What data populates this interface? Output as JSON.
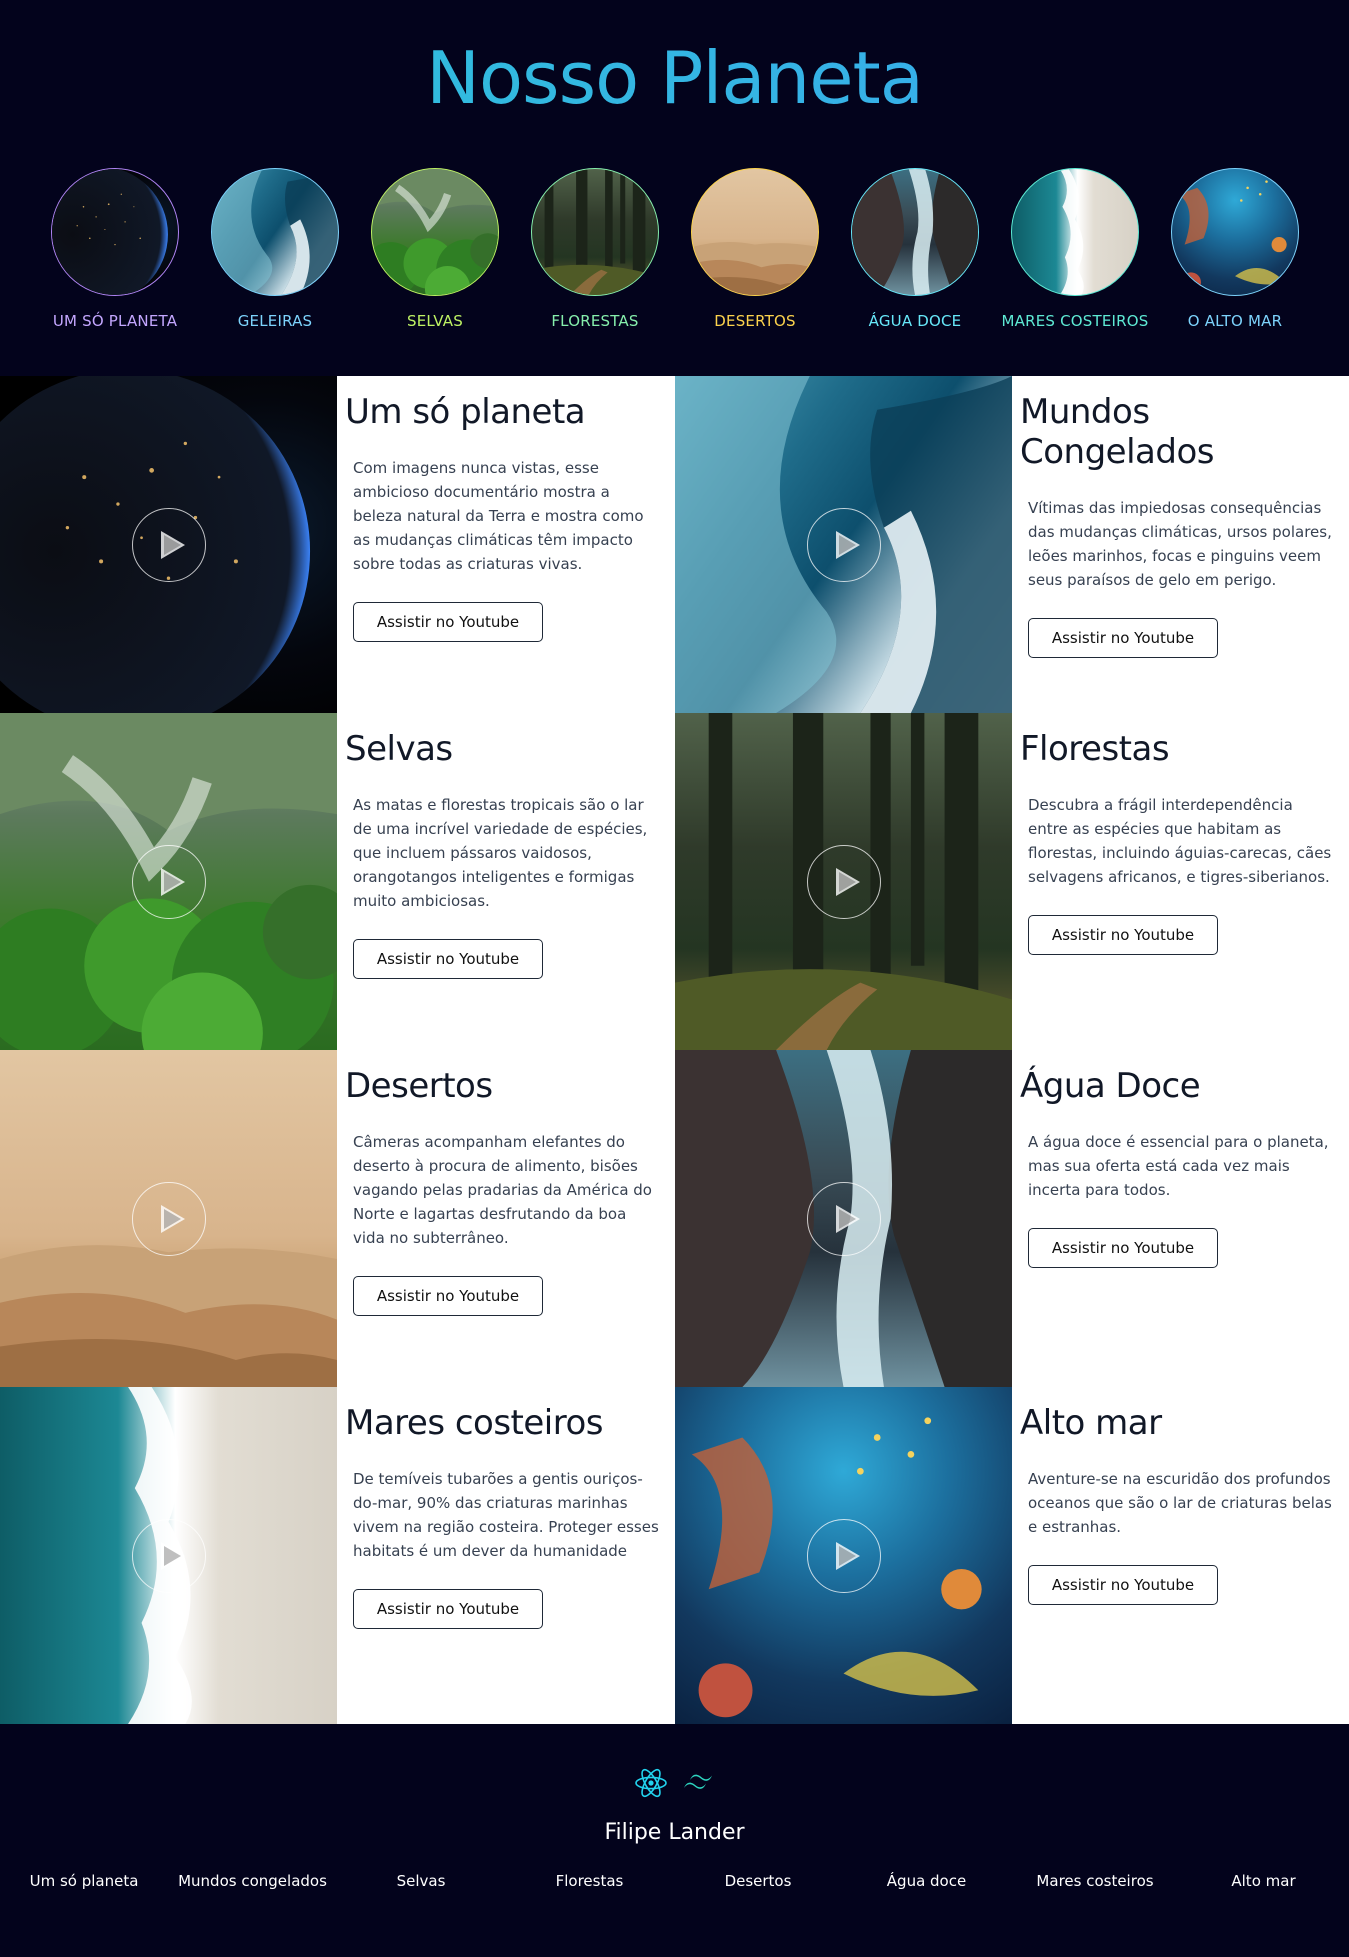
{
  "header": {
    "title": "Nosso Planeta",
    "circles": [
      {
        "label": "UM SÓ PLANETA",
        "color": "#c4a7ff",
        "border": "#b085f5",
        "img": "planeta"
      },
      {
        "label": "GELEIRAS",
        "color": "#7dd3fc",
        "border": "#7dd3fc",
        "img": "geleiras"
      },
      {
        "label": "SELVAS",
        "color": "#bef264",
        "border": "#bef264",
        "img": "selvas"
      },
      {
        "label": "FLORESTAS",
        "color": "#86efac",
        "border": "#86efac",
        "img": "florestas"
      },
      {
        "label": "DESERTOS",
        "color": "#fcd34d",
        "border": "#fcd34d",
        "img": "desertos"
      },
      {
        "label": "ÁGUA DOCE",
        "color": "#67e8f9",
        "border": "#67e8f9",
        "img": "agua"
      },
      {
        "label": "MARES COSTEIROS",
        "color": "#5eead4",
        "border": "#5eead4",
        "img": "mares"
      },
      {
        "label": "O ALTO MAR",
        "color": "#7dd3fc",
        "border": "#7dd3fc",
        "img": "altomar"
      }
    ]
  },
  "cards": [
    {
      "title": "Um só planeta",
      "text": "Com imagens nunca vistas, esse ambicioso documentário mostra a beleza natural da Terra e mostra como as mudanças climáticas têm impacto sobre todas as criaturas vivas.",
      "button": "Assistir no Youtube",
      "img": "planeta"
    },
    {
      "title": "Mundos Congelados",
      "text": "Vítimas das impiedosas consequências das mudanças climáticas, ursos polares, leões marinhos, focas e pinguins veem seus paraísos de gelo em perigo.",
      "button": "Assistir no Youtube",
      "img": "geleiras"
    },
    {
      "title": "Selvas",
      "text": "As matas e florestas tropicais são o lar de uma incrível variedade de espécies, que incluem pássaros vaidosos, orangotangos inteligentes e formigas muito ambiciosas.",
      "button": "Assistir no Youtube",
      "img": "selvas"
    },
    {
      "title": "Florestas",
      "text": "Descubra a frágil interdependência entre as espécies que habitam as florestas, incluindo águias-carecas, cães selvagens africanos, e tigres-siberianos.",
      "button": "Assistir no Youtube",
      "img": "florestas"
    },
    {
      "title": "Desertos",
      "text": "Câmeras acompanham elefantes do deserto à procura de alimento, bisões vagando pelas pradarias da América do Norte e lagartas desfrutando da boa vida no subterrâneo.",
      "button": "Assistir no Youtube",
      "img": "desertos"
    },
    {
      "title": "Água Doce",
      "text": "A água doce é essencial para o planeta, mas sua oferta está cada vez mais incerta para todos.",
      "button": "Assistir no Youtube",
      "img": "agua"
    },
    {
      "title": "Mares costeiros",
      "text": "De temíveis tubarões a gentis ouriços-do-mar, 90% das criaturas marinhas vivem na região costeira. Proteger esses habitats é um dever da humanidade",
      "button": "Assistir no Youtube",
      "img": "mares"
    },
    {
      "title": "Alto mar",
      "text": "Aventure-se na escuridão dos profundos oceanos que são o lar de criaturas belas e estranhas.",
      "button": "Assistir no Youtube",
      "img": "altomar"
    }
  ],
  "footer": {
    "icons": [
      "react-icon",
      "tailwind-icon"
    ],
    "name": "Filipe Lander",
    "links": [
      "Um só planeta",
      "Mundos congelados",
      "Selvas",
      "Florestas",
      "Desertos",
      "Água doce",
      "Mares costeiros",
      "Alto mar"
    ]
  }
}
